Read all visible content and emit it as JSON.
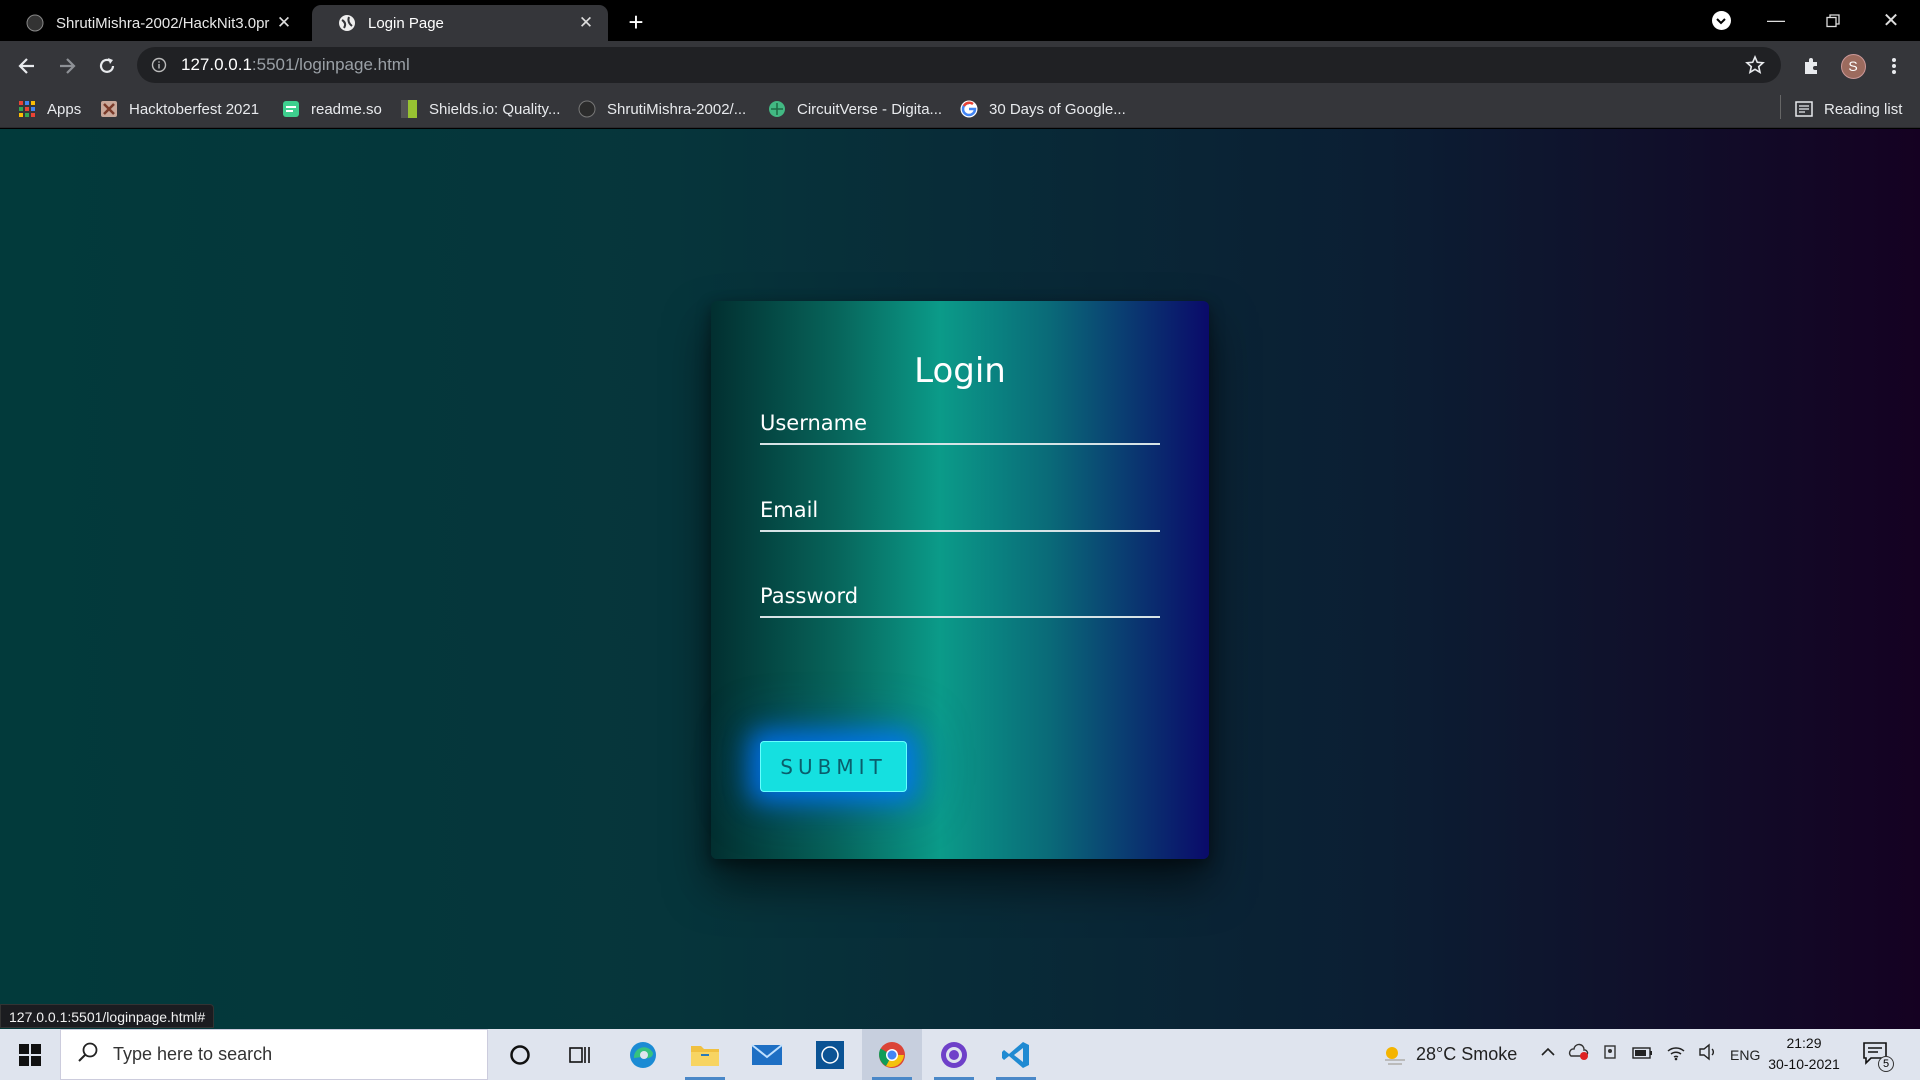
{
  "browser": {
    "tabs": [
      {
        "title": "ShrutiMishra-2002/HackNit3.0pr",
        "favicon": "github-icon",
        "active": false
      },
      {
        "title": "Login Page",
        "favicon": "globe-icon",
        "active": true
      }
    ],
    "address": {
      "host": "127.0.0.1",
      "port_path": ":5501/loginpage.html"
    },
    "profile_initial": "S",
    "bookmarks": [
      {
        "label": "Apps",
        "icon": "apps-grid-icon"
      },
      {
        "label": "Hacktoberfest 2021",
        "icon": "hacktoberfest-icon"
      },
      {
        "label": "readme.so",
        "icon": "readme-icon"
      },
      {
        "label": "Shields.io: Quality...",
        "icon": "shields-icon"
      },
      {
        "label": "ShrutiMishra-2002/...",
        "icon": "github-icon"
      },
      {
        "label": "CircuitVerse - Digita...",
        "icon": "circuitverse-icon"
      },
      {
        "label": "30 Days of Google...",
        "icon": "google-icon"
      }
    ],
    "reading_list": "Reading list",
    "status_url": "127.0.0.1:5501/loginpage.html#"
  },
  "login": {
    "title": "Login",
    "username_label": "Username",
    "email_label": "Email",
    "password_label": "Password",
    "submit_label": "SUBMIT"
  },
  "taskbar": {
    "search_placeholder": "Type here to search",
    "weather": "28°C  Smoke",
    "language": "ENG",
    "time": "21:29",
    "date": "30-10-2021",
    "notifications": "5"
  },
  "colors": {
    "submit_bg": "#15e0e0",
    "card_mid": "#0b9b89",
    "page_left": "#023a3b",
    "page_right": "#150122"
  }
}
